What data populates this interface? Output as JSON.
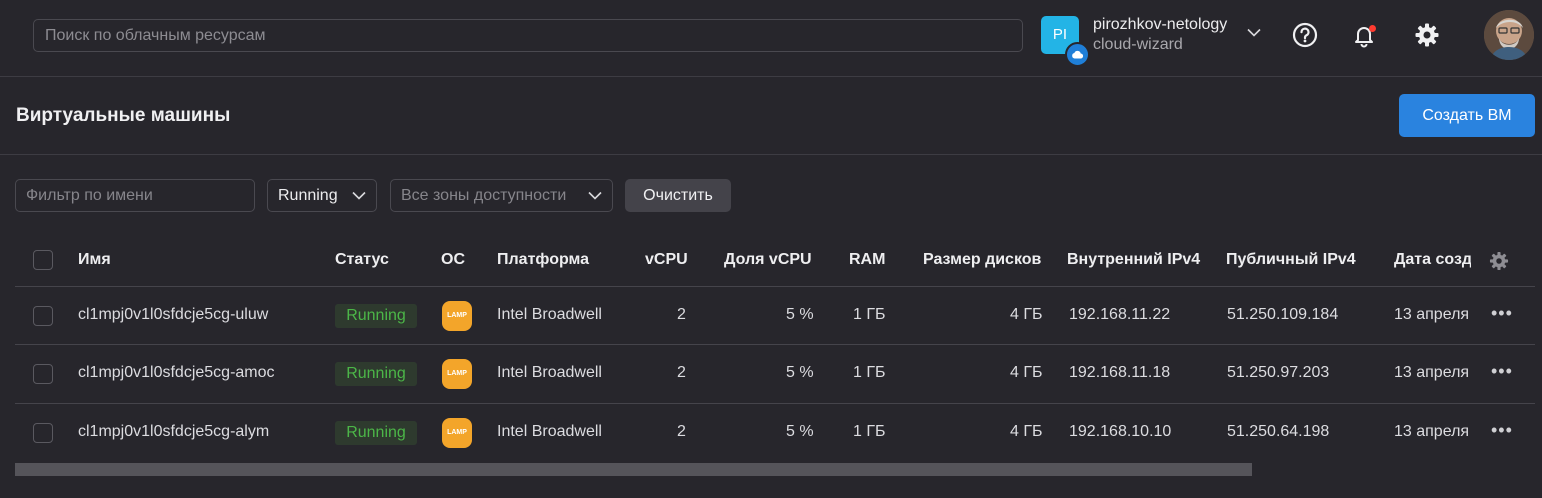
{
  "header": {
    "search_placeholder": "Поиск по облачным ресурсам",
    "account_initials": "PI",
    "account_name": "pirozhkov-netology",
    "folder_name": "cloud-wizard"
  },
  "page": {
    "title": "Виртуальные машины",
    "create_label": "Создать ВМ"
  },
  "filters": {
    "name_placeholder": "Фильтр по имени",
    "status_value": "Running",
    "zone_placeholder": "Все зоны доступности",
    "clear_label": "Очистить"
  },
  "table": {
    "columns": {
      "name": "Имя",
      "status": "Статус",
      "os": "ОС",
      "platform": "Платформа",
      "vcpu": "vCPU",
      "vcpu_share": "Доля vCPU",
      "ram": "RAM",
      "disk": "Размер дисков",
      "internal_ip": "Внутренний IPv4",
      "public_ip": "Публичный IPv4",
      "created": "Дата созд"
    },
    "rows": [
      {
        "name": "cl1mpj0v1l0sfdcje5cg-uluw",
        "status": "Running",
        "os": "LAMP",
        "platform": "Intel Broadwell",
        "vcpu": "2",
        "vcpu_share": "5 %",
        "ram": "1 ГБ",
        "disk": "4 ГБ",
        "internal_ip": "192.168.11.22",
        "public_ip": "51.250.109.184",
        "created": "13 апреля"
      },
      {
        "name": "cl1mpj0v1l0sfdcje5cg-amoc",
        "status": "Running",
        "os": "LAMP",
        "platform": "Intel Broadwell",
        "vcpu": "2",
        "vcpu_share": "5 %",
        "ram": "1 ГБ",
        "disk": "4 ГБ",
        "internal_ip": "192.168.11.18",
        "public_ip": "51.250.97.203",
        "created": "13 апреля"
      },
      {
        "name": "cl1mpj0v1l0sfdcje5cg-alym",
        "status": "Running",
        "os": "LAMP",
        "platform": "Intel Broadwell",
        "vcpu": "2",
        "vcpu_share": "5 %",
        "ram": "1 ГБ",
        "disk": "4 ГБ",
        "internal_ip": "192.168.10.10",
        "public_ip": "51.250.64.198",
        "created": "13 апреля"
      }
    ]
  },
  "colors": {
    "accent": "#2a83df",
    "status_green": "#4cb648",
    "background": "#27262c"
  }
}
